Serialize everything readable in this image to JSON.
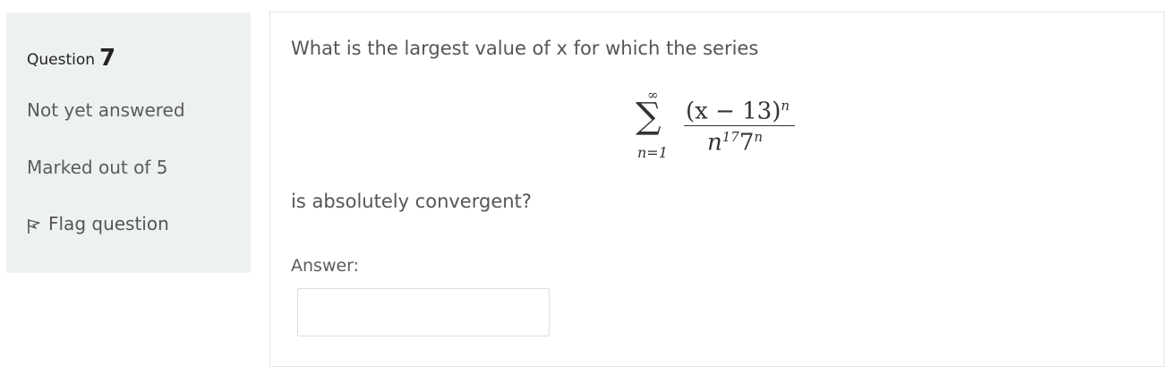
{
  "question_info": {
    "label": "Question",
    "number": "7",
    "state": "Not yet answered",
    "grade": "Marked out of 5",
    "flag_label": "Flag question",
    "flag_icon": "flag-icon"
  },
  "question": {
    "text_before": "What is the largest value of x for which the series",
    "formula": {
      "upper_limit": "∞",
      "sum_symbol": "∑",
      "lower_limit": "n=1",
      "numerator_base": "(x − 13)",
      "numerator_exp": "n",
      "denominator_base": "n",
      "denominator_exp1": "17",
      "denominator_mid": "7",
      "denominator_exp2": "n"
    },
    "text_after": "is absolutely convergent?",
    "answer_label": "Answer:",
    "answer_value": ""
  }
}
